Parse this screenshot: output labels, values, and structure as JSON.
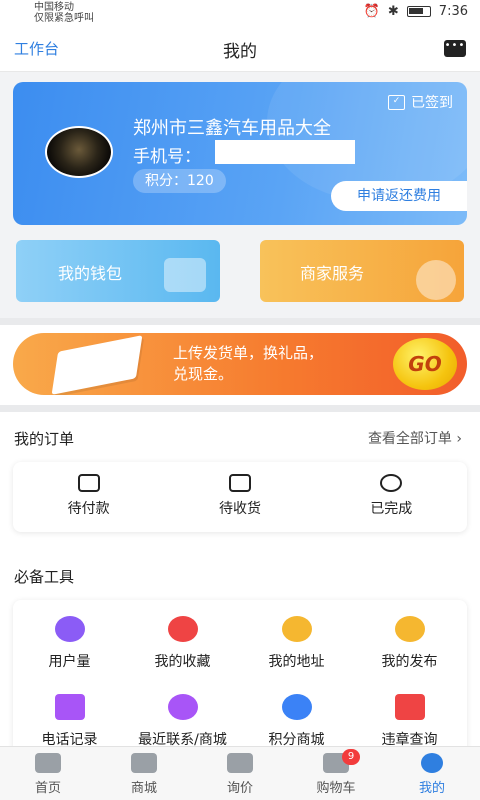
{
  "status_bar": {
    "carrier_line1": "中国移动",
    "carrier_line2": "仅限紧急呼叫",
    "time": "7:36"
  },
  "header": {
    "left_link": "工作台",
    "title": "我的",
    "icon": "message-icon"
  },
  "profile": {
    "signed_in": "已签到",
    "shop_name": "郑州市三鑫汽车用品大全",
    "phone_label": "手机号：",
    "points": "积分：120",
    "refund_button": "申请返还费用"
  },
  "tiles": {
    "wallet": "我的钱包",
    "merchant": "商家服务"
  },
  "banner": {
    "line1": "上传发货单，换礼品，",
    "line2": "兑现金。",
    "go": "GO"
  },
  "orders": {
    "title": "我的订单",
    "view_all": "查看全部订单",
    "items": [
      {
        "label": "待付款",
        "icon": "wallet-icon"
      },
      {
        "label": "待收货",
        "icon": "truck-icon"
      },
      {
        "label": "已完成",
        "icon": "check-circle-icon"
      }
    ]
  },
  "tools": {
    "title": "必备工具",
    "items": [
      {
        "label": "用户量",
        "icon": "pie-chart-icon",
        "color": "#8b5cf6"
      },
      {
        "label": "我的收藏",
        "icon": "heart-icon",
        "color": "#ef4444"
      },
      {
        "label": "我的地址",
        "icon": "location-icon",
        "color": "#f5b730"
      },
      {
        "label": "我的发布",
        "icon": "pen-icon",
        "color": "#f5b730"
      },
      {
        "label": "电话记录",
        "icon": "phone-record-icon",
        "color": "#a855f7"
      },
      {
        "label": "最近联系/商城",
        "icon": "chat-icon",
        "color": "#a855f7"
      },
      {
        "label": "积分商城",
        "icon": "star-icon",
        "color": "#3b82f6"
      },
      {
        "label": "违章查询",
        "icon": "search-document-icon",
        "color": "#ef4444"
      }
    ]
  },
  "bottom_nav": {
    "items": [
      {
        "label": "首页",
        "icon": "home-icon"
      },
      {
        "label": "商城",
        "icon": "bag-icon"
      },
      {
        "label": "询价",
        "icon": "card-icon"
      },
      {
        "label": "购物车",
        "icon": "cart-icon",
        "badge": "9"
      },
      {
        "label": "我的",
        "icon": "user-icon"
      }
    ]
  }
}
